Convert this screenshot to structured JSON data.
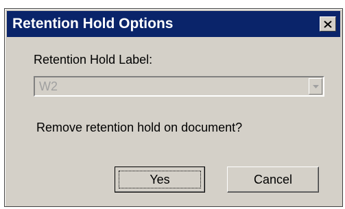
{
  "window": {
    "title": "Retention Hold Options",
    "close_icon": "close-icon"
  },
  "form": {
    "label": "Retention Hold Label:",
    "combo_value": "W2",
    "combo_disabled": true,
    "question": "Remove retention hold on document?"
  },
  "buttons": {
    "yes_label": "Yes",
    "cancel_label": "Cancel"
  },
  "colors": {
    "titlebar": "#0a246a",
    "dialog_face": "#d4d0c8",
    "disabled_text": "#a0a0a0"
  }
}
